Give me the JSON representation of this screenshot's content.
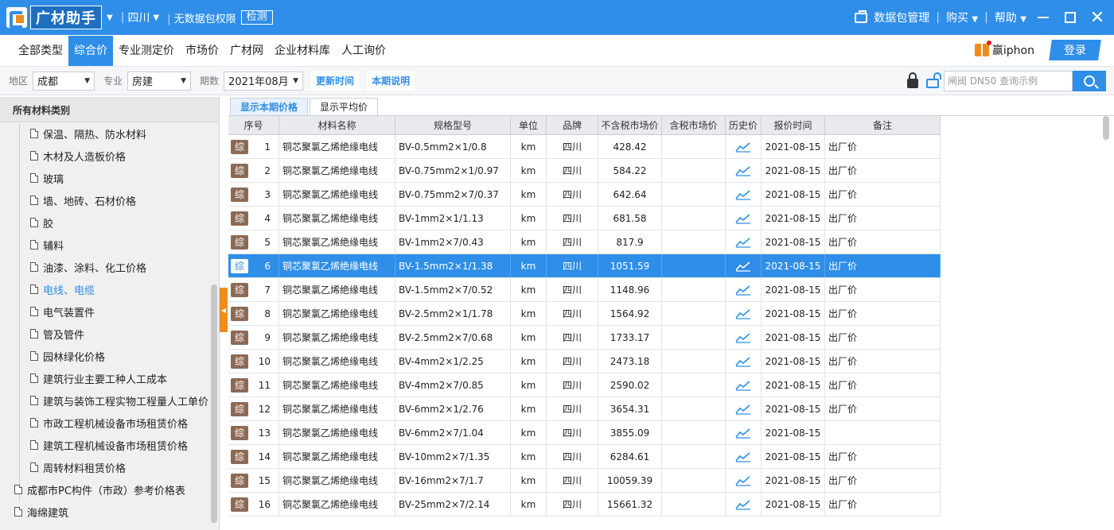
{
  "titlebar": {
    "logo_text": "广材助手",
    "region": "四川",
    "perm_text": "无数据包权限",
    "check_label": "检测",
    "data_pkg_label": "数据包管理",
    "buy_label": "购买",
    "help_label": "帮助"
  },
  "nav": {
    "tabs": [
      {
        "label": "全部类型"
      },
      {
        "label": "综合价"
      },
      {
        "label": "专业测定价"
      },
      {
        "label": "市场价"
      },
      {
        "label": "广材网"
      },
      {
        "label": "企业材料库"
      },
      {
        "label": "人工询价"
      }
    ],
    "promo_text": "赢iphon",
    "login_label": "登录"
  },
  "filters": {
    "area_label": "地区",
    "area_value": "成都",
    "major_label": "专业",
    "major_value": "房建",
    "period_label": "期数",
    "period_value": "2021年08月",
    "update_time_label": "更新时间",
    "period_note_label": "本期说明",
    "search_placeholder": "闸阀 DN50 查询示例"
  },
  "sidebar": {
    "header": "所有材料类别",
    "items": [
      {
        "label": "保温、隔热、防水材料",
        "level": 2
      },
      {
        "label": "木材及人造板价格",
        "level": 2
      },
      {
        "label": "玻璃",
        "level": 2
      },
      {
        "label": "墙、地砖、石材价格",
        "level": 2
      },
      {
        "label": "胶",
        "level": 2
      },
      {
        "label": "辅料",
        "level": 2
      },
      {
        "label": "油漆、涂料、化工价格",
        "level": 2
      },
      {
        "label": "电线、电缆",
        "level": 2,
        "selected": true
      },
      {
        "label": "电气装置件",
        "level": 2
      },
      {
        "label": "管及管件",
        "level": 2
      },
      {
        "label": "园林绿化价格",
        "level": 2
      },
      {
        "label": "建筑行业主要工种人工成本",
        "level": 2
      },
      {
        "label": "建筑与装饰工程实物工程量人工单价",
        "level": 2
      },
      {
        "label": "市政工程机械设备市场租赁价格",
        "level": 2
      },
      {
        "label": "建筑工程机械设备市场租赁价格",
        "level": 2
      },
      {
        "label": "周转材料租赁价格",
        "level": 2
      },
      {
        "label": "成都市PC构件（市政）参考价格表",
        "level": 1
      },
      {
        "label": "海绵建筑",
        "level": 1
      }
    ]
  },
  "subtabs": [
    {
      "label": "显示本期价格",
      "active": true
    },
    {
      "label": "显示平均价",
      "active": false
    }
  ],
  "table": {
    "headers": [
      "序号",
      "材料名称",
      "规格型号",
      "单位",
      "品牌",
      "不含税市场价",
      "含税市场价",
      "历史价",
      "报价时间",
      "备注"
    ],
    "badge": "综",
    "rows": [
      {
        "no": "1",
        "name": "铜芯聚氯乙烯绝缘电线",
        "spec": "BV-0.5mm2×1/0.8",
        "unit": "km",
        "brand": "四川",
        "price": "428.42",
        "tax_price": "",
        "date": "2021-08-15",
        "note": "出厂价"
      },
      {
        "no": "2",
        "name": "铜芯聚氯乙烯绝缘电线",
        "spec": "BV-0.75mm2×1/0.97",
        "unit": "km",
        "brand": "四川",
        "price": "584.22",
        "tax_price": "",
        "date": "2021-08-15",
        "note": "出厂价"
      },
      {
        "no": "3",
        "name": "铜芯聚氯乙烯绝缘电线",
        "spec": "BV-0.75mm2×7/0.37",
        "unit": "km",
        "brand": "四川",
        "price": "642.64",
        "tax_price": "",
        "date": "2021-08-15",
        "note": "出厂价"
      },
      {
        "no": "4",
        "name": "铜芯聚氯乙烯绝缘电线",
        "spec": "BV-1mm2×1/1.13",
        "unit": "km",
        "brand": "四川",
        "price": "681.58",
        "tax_price": "",
        "date": "2021-08-15",
        "note": "出厂价"
      },
      {
        "no": "5",
        "name": "铜芯聚氯乙烯绝缘电线",
        "spec": "BV-1mm2×7/0.43",
        "unit": "km",
        "brand": "四川",
        "price": "817.9",
        "tax_price": "",
        "date": "2021-08-15",
        "note": "出厂价"
      },
      {
        "no": "6",
        "name": "铜芯聚氯乙烯绝缘电线",
        "spec": "BV-1.5mm2×1/1.38",
        "unit": "km",
        "brand": "四川",
        "price": "1051.59",
        "tax_price": "",
        "date": "2021-08-15",
        "note": "出厂价",
        "selected": true
      },
      {
        "no": "7",
        "name": "铜芯聚氯乙烯绝缘电线",
        "spec": "BV-1.5mm2×7/0.52",
        "unit": "km",
        "brand": "四川",
        "price": "1148.96",
        "tax_price": "",
        "date": "2021-08-15",
        "note": "出厂价"
      },
      {
        "no": "8",
        "name": "铜芯聚氯乙烯绝缘电线",
        "spec": "BV-2.5mm2×1/1.78",
        "unit": "km",
        "brand": "四川",
        "price": "1564.92",
        "tax_price": "",
        "date": "2021-08-15",
        "note": "出厂价"
      },
      {
        "no": "9",
        "name": "铜芯聚氯乙烯绝缘电线",
        "spec": "BV-2.5mm2×7/0.68",
        "unit": "km",
        "brand": "四川",
        "price": "1733.17",
        "tax_price": "",
        "date": "2021-08-15",
        "note": "出厂价"
      },
      {
        "no": "10",
        "name": "铜芯聚氯乙烯绝缘电线",
        "spec": "BV-4mm2×1/2.25",
        "unit": "km",
        "brand": "四川",
        "price": "2473.18",
        "tax_price": "",
        "date": "2021-08-15",
        "note": "出厂价"
      },
      {
        "no": "11",
        "name": "铜芯聚氯乙烯绝缘电线",
        "spec": "BV-4mm2×7/0.85",
        "unit": "km",
        "brand": "四川",
        "price": "2590.02",
        "tax_price": "",
        "date": "2021-08-15",
        "note": "出厂价"
      },
      {
        "no": "12",
        "name": "铜芯聚氯乙烯绝缘电线",
        "spec": "BV-6mm2×1/2.76",
        "unit": "km",
        "brand": "四川",
        "price": "3654.31",
        "tax_price": "",
        "date": "2021-08-15",
        "note": "出厂价"
      },
      {
        "no": "13",
        "name": "铜芯聚氯乙烯绝缘电线",
        "spec": "BV-6mm2×7/1.04",
        "unit": "km",
        "brand": "四川",
        "price": "3855.09",
        "tax_price": "",
        "date": "2021-08-15",
        "note": ""
      },
      {
        "no": "14",
        "name": "铜芯聚氯乙烯绝缘电线",
        "spec": "BV-10mm2×7/1.35",
        "unit": "km",
        "brand": "四川",
        "price": "6284.61",
        "tax_price": "",
        "date": "2021-08-15",
        "note": "出厂价"
      },
      {
        "no": "15",
        "name": "铜芯聚氯乙烯绝缘电线",
        "spec": "BV-16mm2×7/1.7",
        "unit": "km",
        "brand": "四川",
        "price": "10059.39",
        "tax_price": "",
        "date": "2021-08-15",
        "note": "出厂价"
      },
      {
        "no": "16",
        "name": "铜芯聚氯乙烯绝缘电线",
        "spec": "BV-25mm2×7/2.14",
        "unit": "km",
        "brand": "四川",
        "price": "15661.32",
        "tax_price": "",
        "date": "2021-08-15",
        "note": "出厂价"
      }
    ]
  },
  "colors": {
    "brand_blue": "#2f8ee7",
    "accent_orange": "#f08c1c",
    "badge_brown": "#8b6a54"
  }
}
